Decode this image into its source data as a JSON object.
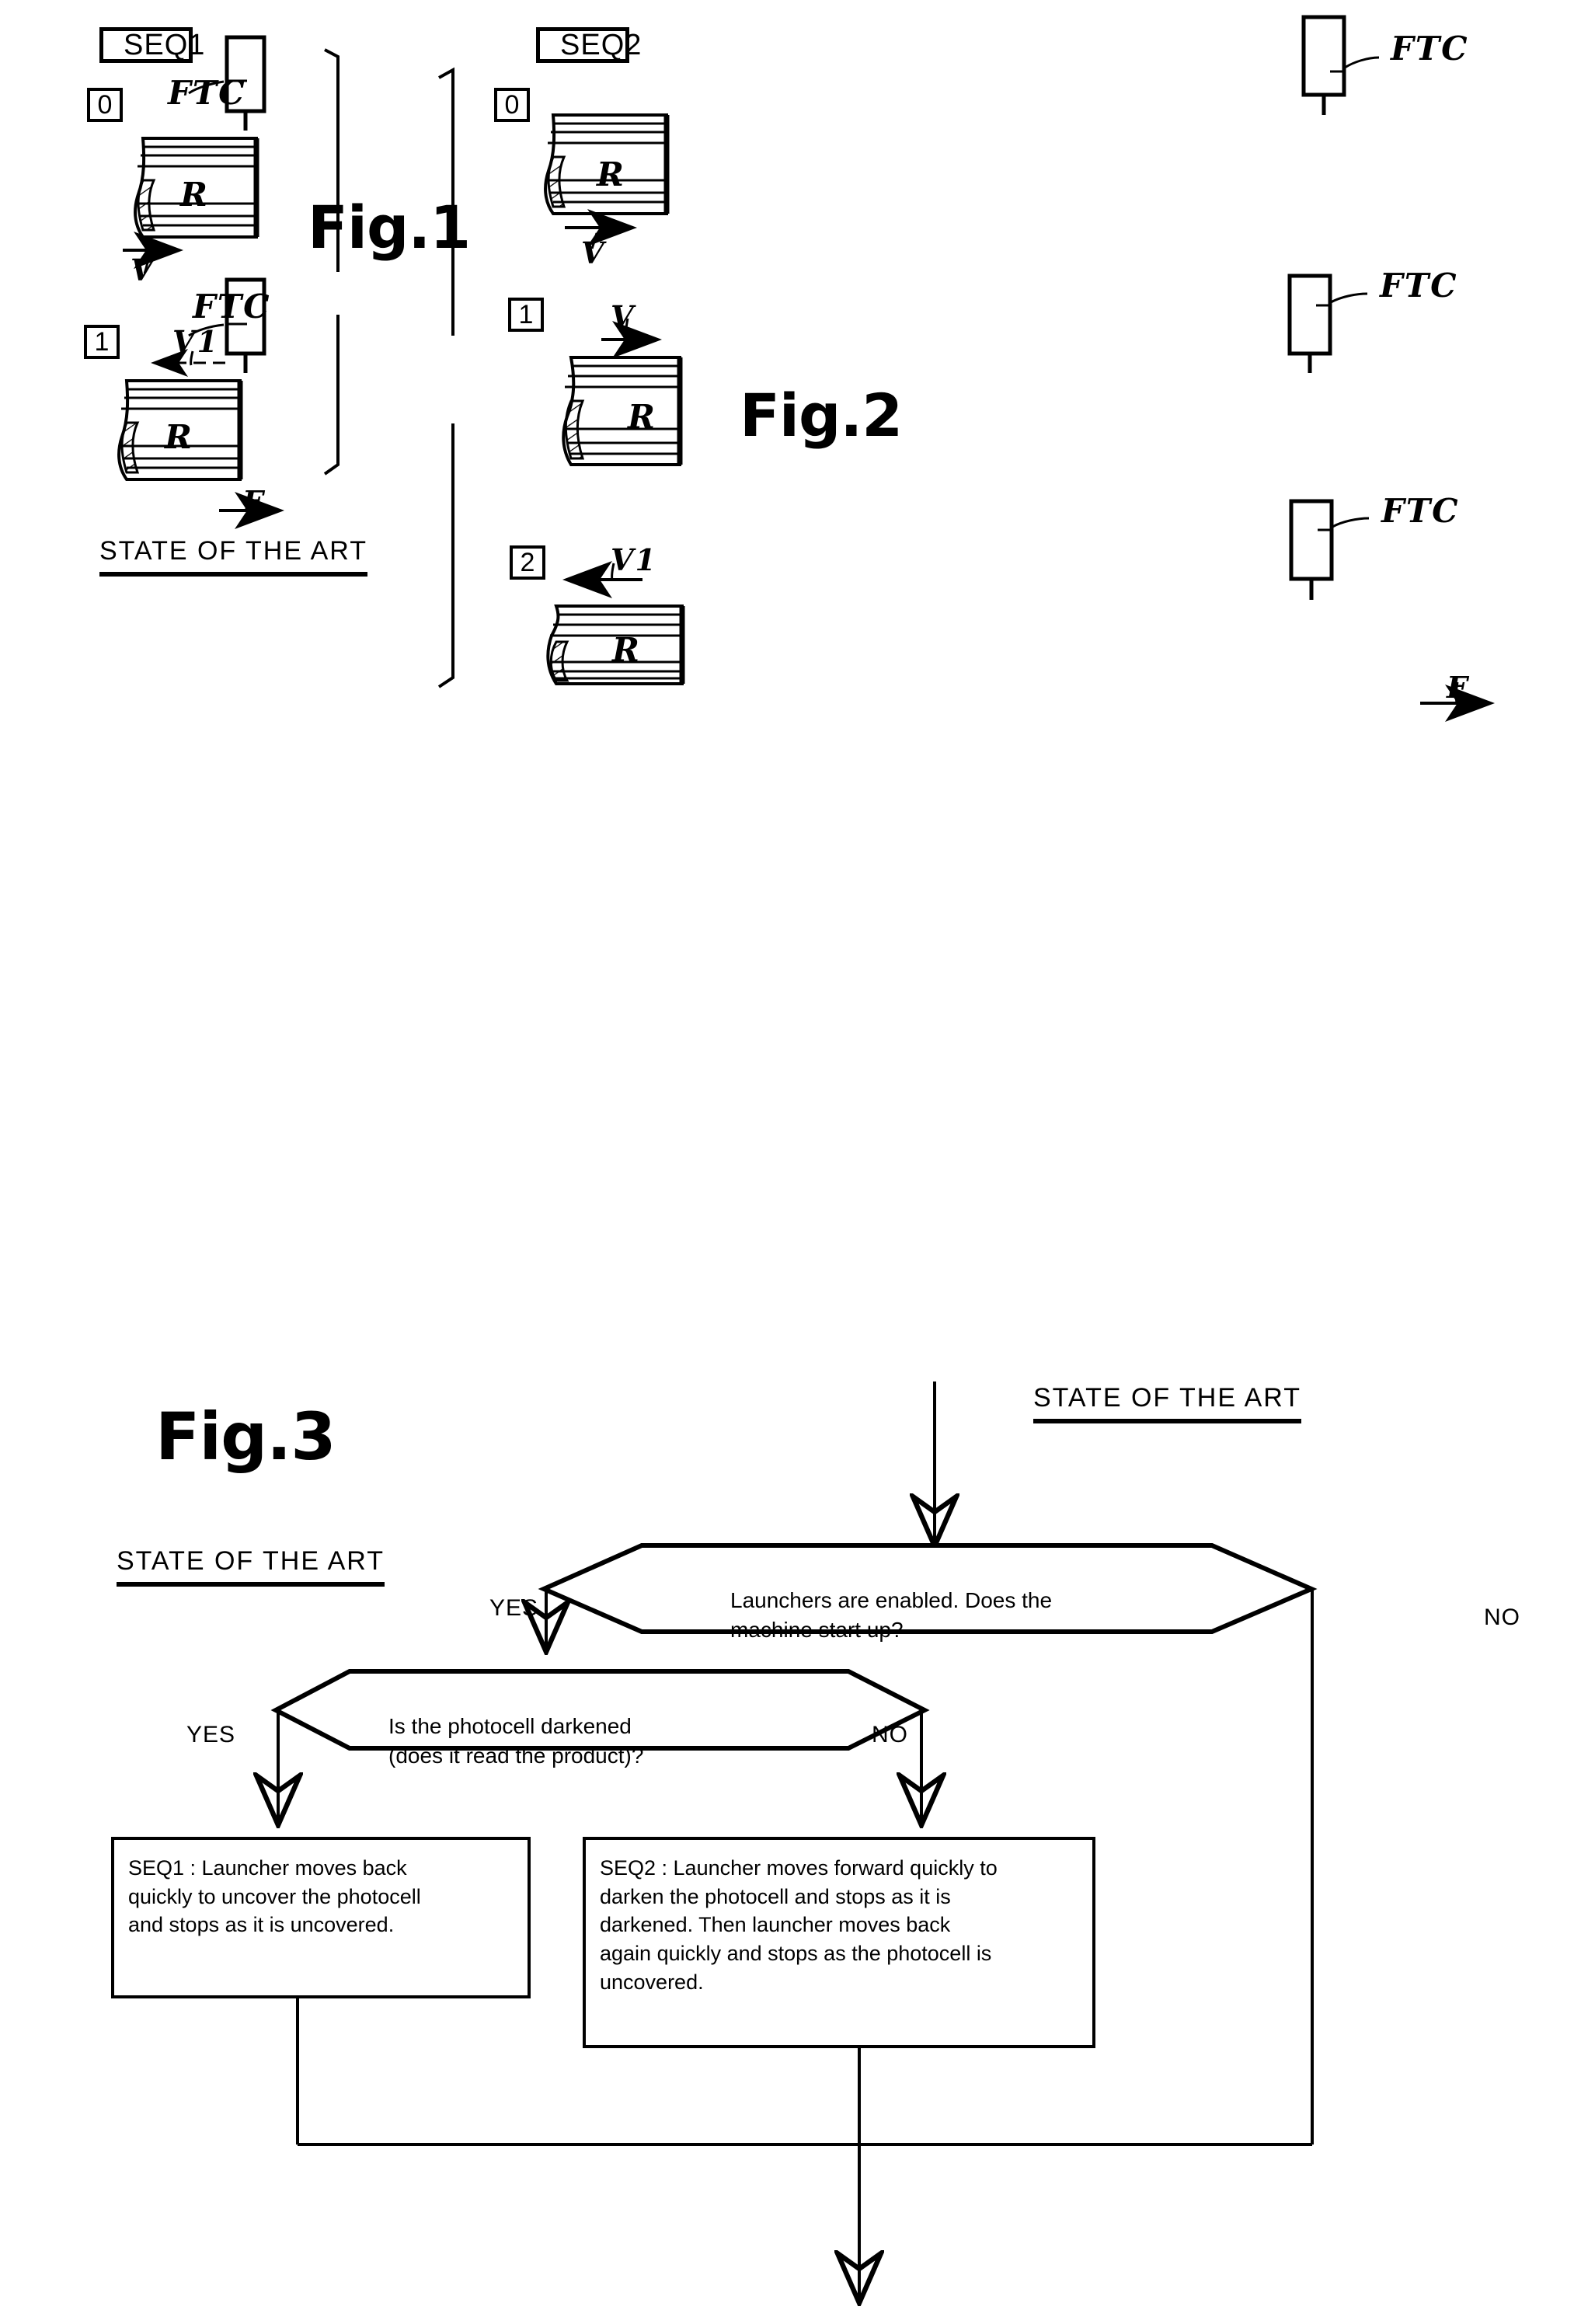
{
  "figures": {
    "fig1": {
      "label": "Fig.1",
      "sequence_label": "SEQ1",
      "caption": "STATE OF THE ART",
      "steps": [
        {
          "number": "0",
          "sensor_label": "FTC",
          "arrow_label": "V",
          "roll_label": "R"
        },
        {
          "number": "1",
          "sensor_label": "FTC",
          "arrow_label": "V1",
          "roll_label": "R",
          "force_label": "F"
        }
      ]
    },
    "fig2": {
      "label": "Fig.2",
      "sequence_label": "SEQ2",
      "caption": "STATE OF THE ART",
      "steps": [
        {
          "number": "0",
          "sensor_label": "FTC",
          "arrow_label": "V",
          "roll_label": "R"
        },
        {
          "number": "1",
          "sensor_label": "FTC",
          "arrow_label": "V",
          "roll_label": "R"
        },
        {
          "number": "2",
          "sensor_label": "FTC",
          "arrow_label": "V1",
          "roll_label": "R",
          "force_label": "F"
        }
      ]
    },
    "fig3": {
      "label": "Fig.3",
      "caption": "STATE OF THE ART"
    }
  },
  "flowchart": {
    "decision1": {
      "text": "Launchers are enabled. Does the\nmachine start up?",
      "yes_label": "YES",
      "no_label": "NO"
    },
    "decision2": {
      "text": "Is the photocell darkened\n(does it read the product)?",
      "yes_label": "YES",
      "no_label": "NO"
    },
    "box_seq1": {
      "text": "SEQ1 : Launcher moves back\nquickly to uncover the photocell\nand stops as it is uncovered."
    },
    "box_seq2": {
      "text": "SEQ2 : Launcher moves forward quickly to\ndarken the photocell and stops as it is\ndarkened. Then launcher moves back\nagain quickly and stops as the photocell is\nuncovered."
    }
  },
  "colors": {
    "ink": "#000000",
    "paper": "#ffffff"
  }
}
